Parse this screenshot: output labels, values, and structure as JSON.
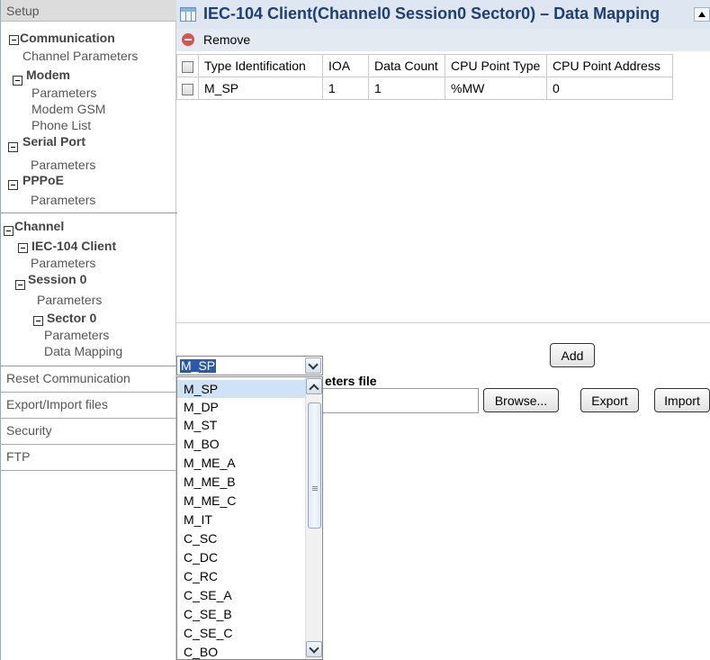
{
  "nav": {
    "setup_header": "Setup",
    "communication": {
      "title": "Communication",
      "channel_parameters": "Channel Parameters",
      "modem": {
        "title": "Modem",
        "items": [
          "Parameters",
          "Modem GSM",
          "Phone List"
        ]
      },
      "serial_port": {
        "title": "Serial Port",
        "items": [
          "Parameters"
        ]
      },
      "pppoe": {
        "title": "PPPoE",
        "items": [
          "Parameters"
        ]
      }
    },
    "channel": {
      "title": "Channel",
      "iec104_client": {
        "title": "IEC-104 Client",
        "parameters": "Parameters"
      },
      "session0": {
        "title": "Session 0",
        "parameters": "Parameters"
      },
      "sector0": {
        "title": "Sector 0",
        "items": [
          "Parameters",
          "Data Mapping"
        ]
      }
    },
    "menu": [
      "Reset Communication",
      "Export/Import files",
      "Security",
      "FTP"
    ]
  },
  "panel": {
    "title": "IEC-104 Client(Channel0 Session0 Sector0) – Data Mapping",
    "toolbar": {
      "remove_label": "Remove"
    },
    "columns": [
      "Type Identification",
      "IOA",
      "Data Count",
      "CPU Point Type",
      "CPU Point Address"
    ],
    "rows": [
      {
        "type": "M_SP",
        "ioa": "1",
        "count": "1",
        "point_type": "%MW",
        "address": "0"
      }
    ]
  },
  "add_button": "Add",
  "params_file": {
    "label_partial": "eters file",
    "browse_label": "Browse...",
    "export_label": "Export",
    "import_label": "Import"
  },
  "dropdown": {
    "selected": "M_SP",
    "options": [
      "M_SP",
      "M_DP",
      "M_ST",
      "M_BO",
      "M_ME_A",
      "M_ME_B",
      "M_ME_C",
      "M_IT",
      "C_SC",
      "C_DC",
      "C_RC",
      "C_SE_A",
      "C_SE_B",
      "C_SE_C",
      "C_BO"
    ]
  },
  "colors": {
    "title_text": "#1f3f70",
    "title_bar": "#dde6f1",
    "selected_value": "#2b5aa8",
    "selected_option": "#cfe3f7",
    "remove_icon": "#d9534f"
  }
}
